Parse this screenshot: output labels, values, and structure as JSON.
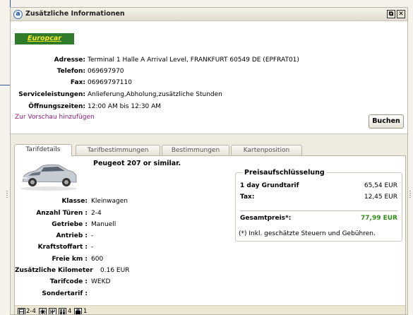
{
  "window": {
    "title": "Zusätzliche Informationen",
    "app_icon_glyph": "a",
    "restore_glyph": "⧉",
    "close_glyph": "✕"
  },
  "vendor": {
    "logo_text": "Europcar",
    "brand_color": "#2f7c2a",
    "logo_text_color": "#f6e826"
  },
  "info": [
    {
      "label": "Adresse:",
      "value": "Terminal 1 Halle A Arrival Level, FRANKFURT 60549 DE (EPFRAT01)"
    },
    {
      "label": "Telefon:",
      "value": "069697970"
    },
    {
      "label": "Fax:",
      "value": "06969797110"
    },
    {
      "label": "Serviceleistungen:",
      "value": "Anlieferung,Abholung,zusätzliche Stunden"
    },
    {
      "label": "Öffnungszeiten:",
      "value": "12:00 AM bis 12:30 AM"
    }
  ],
  "preview_link": "Zur Vorschau hinzufügen",
  "book_button": "Buchen",
  "tabs": [
    {
      "label": "Tarifdetails",
      "active": true
    },
    {
      "label": "Tarifbestimmungen",
      "active": false
    },
    {
      "label": "Bestimmungen",
      "active": false
    },
    {
      "label": "Kartenposition",
      "active": false
    }
  ],
  "car": {
    "name": "Peugeot 207 or similar.",
    "car_color": "#c7ccd2"
  },
  "details": [
    {
      "label": "Klasse:",
      "value": "Kleinwagen"
    },
    {
      "label": "Anzahl Türen :",
      "value": "2-4"
    },
    {
      "label": "Getriebe :",
      "value": "Manuell"
    },
    {
      "label": "Antrieb :",
      "value": "-"
    },
    {
      "label": "Kraftstoffart :",
      "value": "-"
    },
    {
      "label": "Freie km :",
      "value": "600"
    },
    {
      "label": "Zusätzliche Kilometer",
      "value": "0.16 EUR"
    },
    {
      "label": "Tarifcode :",
      "value": "WEKD"
    },
    {
      "label": "Sondertarif :",
      "value": ""
    }
  ],
  "price": {
    "legend": "Preisaufschlüsselung",
    "rows": [
      {
        "label": "1 day Grundtarif",
        "value": "65,54 EUR"
      },
      {
        "label": "Tax:",
        "value": "12,45 EUR"
      }
    ],
    "total_label": "Gesamtpreis*:",
    "total_value": "77,99 EUR",
    "total_color": "#2e8b14",
    "note": "(*) Inkl. geschätzte Steuern und Gebühren."
  },
  "features": {
    "doors": "2-4",
    "passengers": "4",
    "bags": "1"
  }
}
